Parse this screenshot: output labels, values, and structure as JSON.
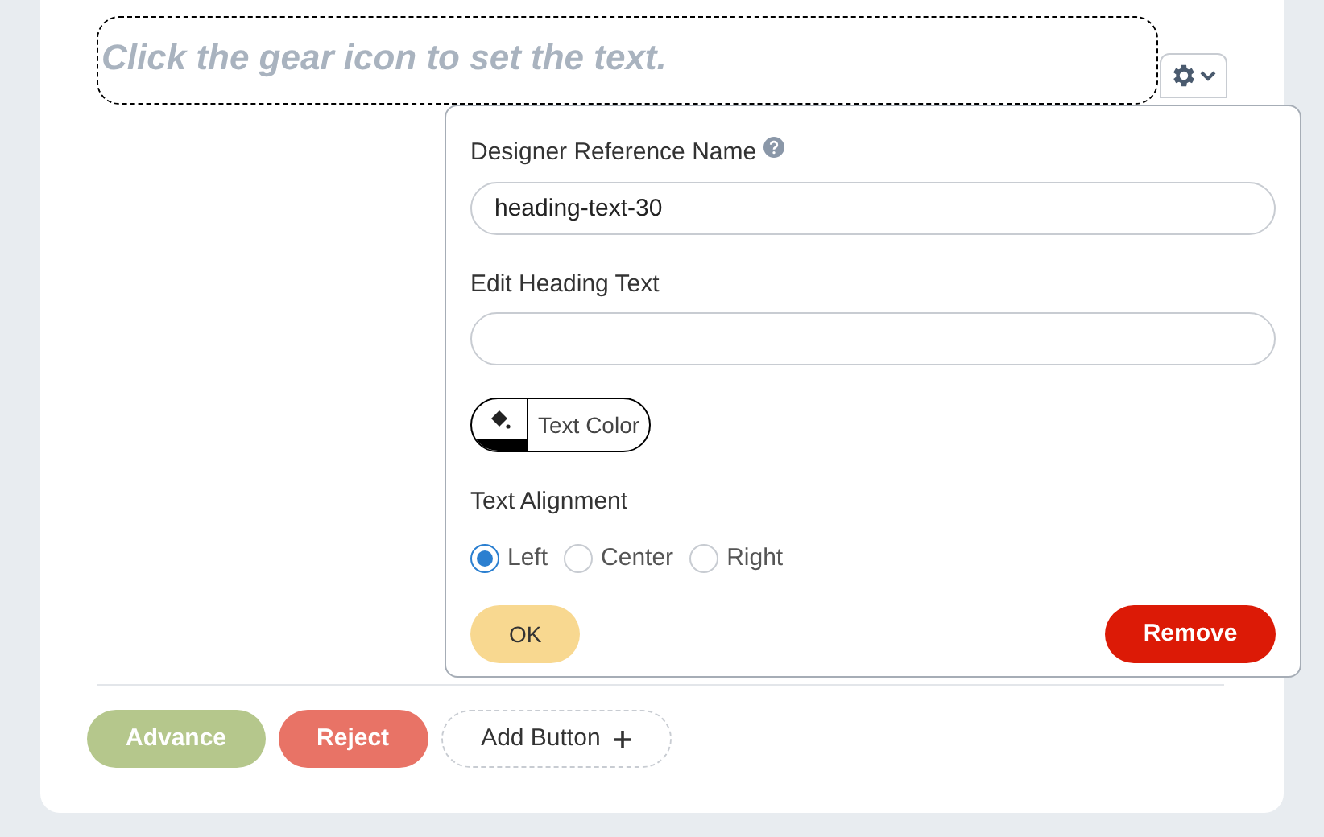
{
  "heading": {
    "placeholder": "Click the gear icon to set the text."
  },
  "settings": {
    "reference_label": "Designer Reference Name",
    "reference_value": "heading-text-30",
    "heading_label": "Edit Heading Text",
    "color_button": {
      "label": "Text Color",
      "color": "#000000"
    },
    "alignment_label": "Text Alignment",
    "alignment_options": [
      {
        "label": "Left",
        "selected": true
      },
      {
        "label": "Center",
        "selected": false
      },
      {
        "label": "Right",
        "selected": false
      }
    ],
    "ok": "OK",
    "remove": "Remove"
  },
  "actions": [
    {
      "label": "Advance",
      "kind": "advance"
    },
    {
      "label": "Reject",
      "kind": "reject"
    },
    {
      "label": "Add Button",
      "kind": "add"
    }
  ]
}
